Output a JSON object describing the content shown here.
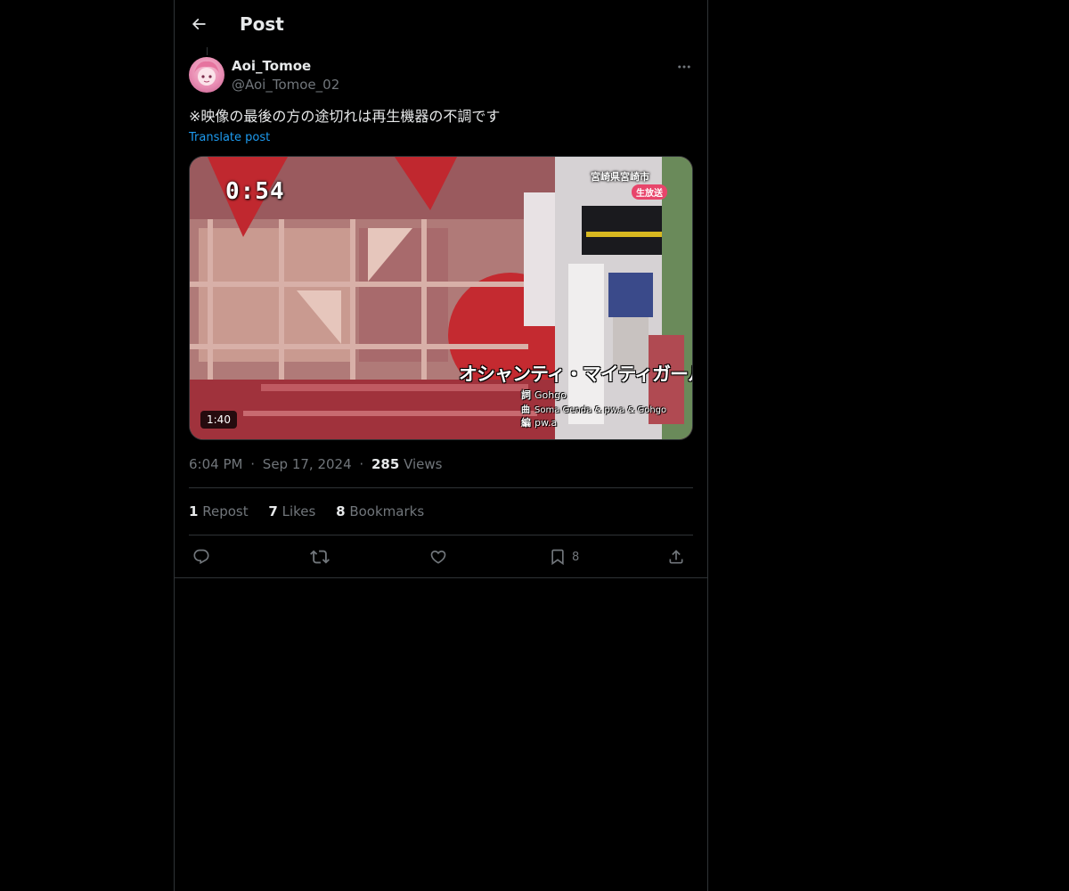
{
  "header": {
    "title": "Post",
    "back_icon": "arrow-left-icon"
  },
  "post": {
    "author_name": "Aoi_Tomoe",
    "author_handle": "@Aoi_Tomoe_02",
    "text": "※映像の最後の方の途切れは再生機器の不調です",
    "translate_label": "Translate post",
    "media": {
      "duration": "1:40",
      "overlay_timer": "0:54",
      "overlay_location": "宮崎県宮崎市",
      "overlay_live": "生放送",
      "overlay_song_title": "オシャンティ・マイティガール",
      "credits": [
        {
          "key": "詞",
          "value": "Gohgo"
        },
        {
          "key": "曲",
          "value": "Soma Genda & pw.a & Gohgo"
        },
        {
          "key": "編",
          "value": "pw.a"
        }
      ]
    },
    "time": "6:04 PM",
    "date": "Sep 17, 2024",
    "views_count": "285",
    "views_label": "Views",
    "separator": "·"
  },
  "stats": {
    "reposts_count": "1",
    "reposts_label": "Repost",
    "likes_count": "7",
    "likes_label": "Likes",
    "bookmarks_count": "8",
    "bookmarks_label": "Bookmarks"
  },
  "actions": {
    "bookmark_count": "8"
  },
  "colors": {
    "background": "#000000",
    "text_primary": "#e7e9ea",
    "text_secondary": "#71767b",
    "accent": "#1d9bf0",
    "border": "#2f3336"
  }
}
